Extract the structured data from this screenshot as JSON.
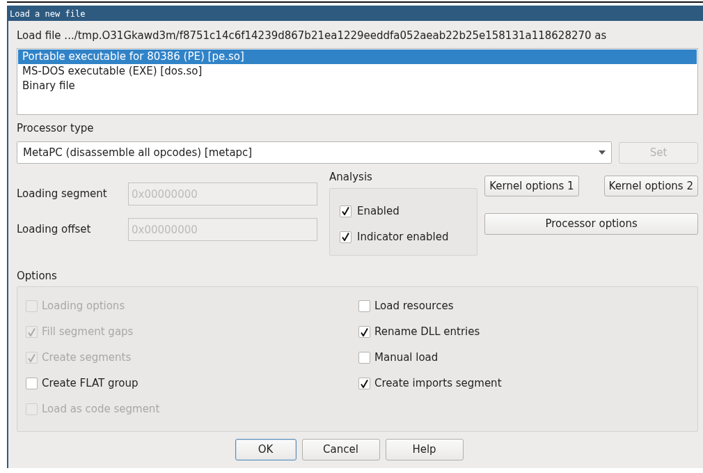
{
  "window": {
    "title": "Load a new file"
  },
  "load_file_label": "Load file .../tmp.O31Gkawd3m/f8751c14c6f14239d867b21ea1229eeddfa052aeab22b25e158131a118628270 as",
  "file_types": [
    {
      "label": "Portable executable for 80386 (PE) [pe.so]",
      "selected": true
    },
    {
      "label": "MS-DOS executable (EXE) [dos.so]",
      "selected": false
    },
    {
      "label": "Binary file",
      "selected": false
    }
  ],
  "processor": {
    "label": "Processor type",
    "value": "MetaPC (disassemble all opcodes) [metapc]",
    "set_button": {
      "label": "Set",
      "disabled": true
    }
  },
  "fields": [
    {
      "label": "Loading segment",
      "value": "0x00000000",
      "disabled": true
    },
    {
      "label": "Loading offset",
      "value": "0x00000000",
      "disabled": true
    }
  ],
  "analysis": {
    "title": "Analysis",
    "options": [
      {
        "label": "Enabled",
        "checked": true
      },
      {
        "label": "Indicator enabled",
        "checked": true
      }
    ]
  },
  "kernel_buttons": [
    {
      "label": "Kernel options 1"
    },
    {
      "label": "Kernel options 2"
    }
  ],
  "processor_options_button": {
    "label": "Processor options"
  },
  "options": {
    "title": "Options",
    "left": [
      {
        "label": "Loading options",
        "checked": false,
        "disabled": true
      },
      {
        "label": "Fill segment gaps",
        "checked": true,
        "disabled": true
      },
      {
        "label": "Create segments",
        "checked": true,
        "disabled": true
      },
      {
        "label": "Create FLAT group",
        "checked": false,
        "disabled": false
      },
      {
        "label": "Load as code segment",
        "checked": false,
        "disabled": true
      }
    ],
    "right": [
      {
        "label": "Load resources",
        "checked": false,
        "disabled": false
      },
      {
        "label": "Rename DLL entries",
        "checked": true,
        "disabled": false
      },
      {
        "label": "Manual load",
        "checked": false,
        "disabled": false
      },
      {
        "label": "Create imports segment",
        "checked": true,
        "disabled": false
      }
    ]
  },
  "buttons": [
    {
      "label": "OK",
      "default": true
    },
    {
      "label": "Cancel",
      "default": false
    },
    {
      "label": "Help",
      "default": false
    }
  ]
}
